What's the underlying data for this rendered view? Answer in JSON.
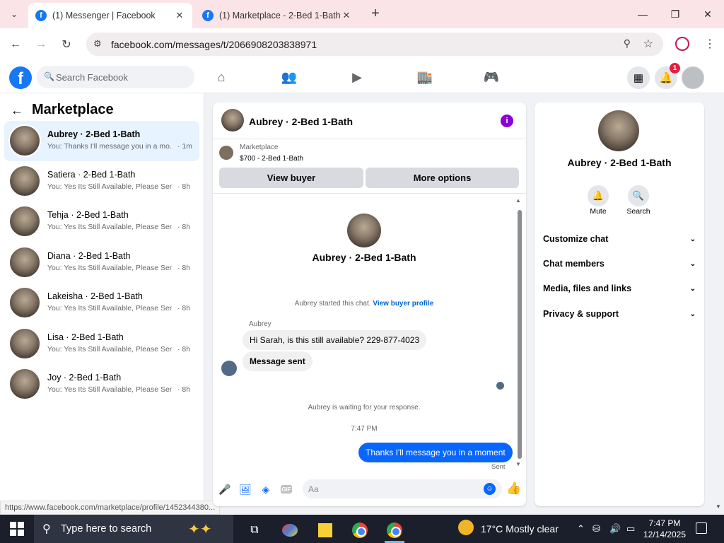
{
  "browser": {
    "tabs": [
      {
        "title": "(1) Messenger | Facebook",
        "active": true
      },
      {
        "title": "(1) Marketplace - 2-Bed 1-Bath",
        "active": false
      }
    ],
    "url": "facebook.com/messages/t/2066908203838971"
  },
  "fb": {
    "search_placeholder": "Search Facebook",
    "notif_count": "1"
  },
  "left": {
    "title": "Marketplace",
    "conversations": [
      {
        "name": "Aubrey · 2-Bed 1-Bath",
        "snippet": "You: Thanks I'll message you in a mo...",
        "time": "· 1m"
      },
      {
        "name": "Satiera · 2-Bed 1-Bath",
        "snippet": "You: Yes Its Still Available, Please Send...",
        "time": "· 8h"
      },
      {
        "name": "Tehja · 2-Bed 1-Bath",
        "snippet": "You: Yes Its Still Available, Please Send...",
        "time": "· 8h"
      },
      {
        "name": "Diana · 2-Bed 1-Bath",
        "snippet": "You: Yes Its Still Available, Please Send...",
        "time": "· 8h"
      },
      {
        "name": "Lakeisha · 2-Bed 1-Bath",
        "snippet": "You: Yes Its Still Available, Please Send...",
        "time": "· 8h"
      },
      {
        "name": "Lisa · 2-Bed 1-Bath",
        "snippet": "You: Yes Its Still Available, Please Send...",
        "time": "· 8h"
      },
      {
        "name": "Joy · 2-Bed 1-Bath",
        "snippet": "You: Yes Its Still Available, Please Send...",
        "time": "· 8h"
      }
    ],
    "status_url": "https://www.facebook.com/marketplace/profile/1452344380..."
  },
  "chat": {
    "header_name": "Aubrey · 2-Bed 1-Bath",
    "marketplace_label": "Marketplace",
    "listing": "$700 - 2-Bed 1-Bath",
    "view_buyer": "View buyer",
    "more_options": "More options",
    "profile_name": "Aubrey · 2-Bed 1-Bath",
    "started_text": "Aubrey started this chat.",
    "view_buyer_profile": "View buyer profile",
    "sender": "Aubrey",
    "msg1": "Hi Sarah, is this still available? 229-877-4023",
    "msg2": "Message sent",
    "waiting": "Aubrey is waiting for your response.",
    "timestamp": "7:47 PM",
    "out_msg": "Thanks I'll message you in a moment",
    "sent": "Sent",
    "composer_placeholder": "Aa"
  },
  "right": {
    "name": "Aubrey · 2-Bed 1-Bath",
    "mute": "Mute",
    "search": "Search",
    "sections": [
      "Customize chat",
      "Chat members",
      "Media, files and links",
      "Privacy & support"
    ]
  },
  "taskbar": {
    "search_placeholder": "Type here to search",
    "weather": "17°C  Mostly clear",
    "time": "7:47 PM",
    "date": "12/14/2025"
  }
}
